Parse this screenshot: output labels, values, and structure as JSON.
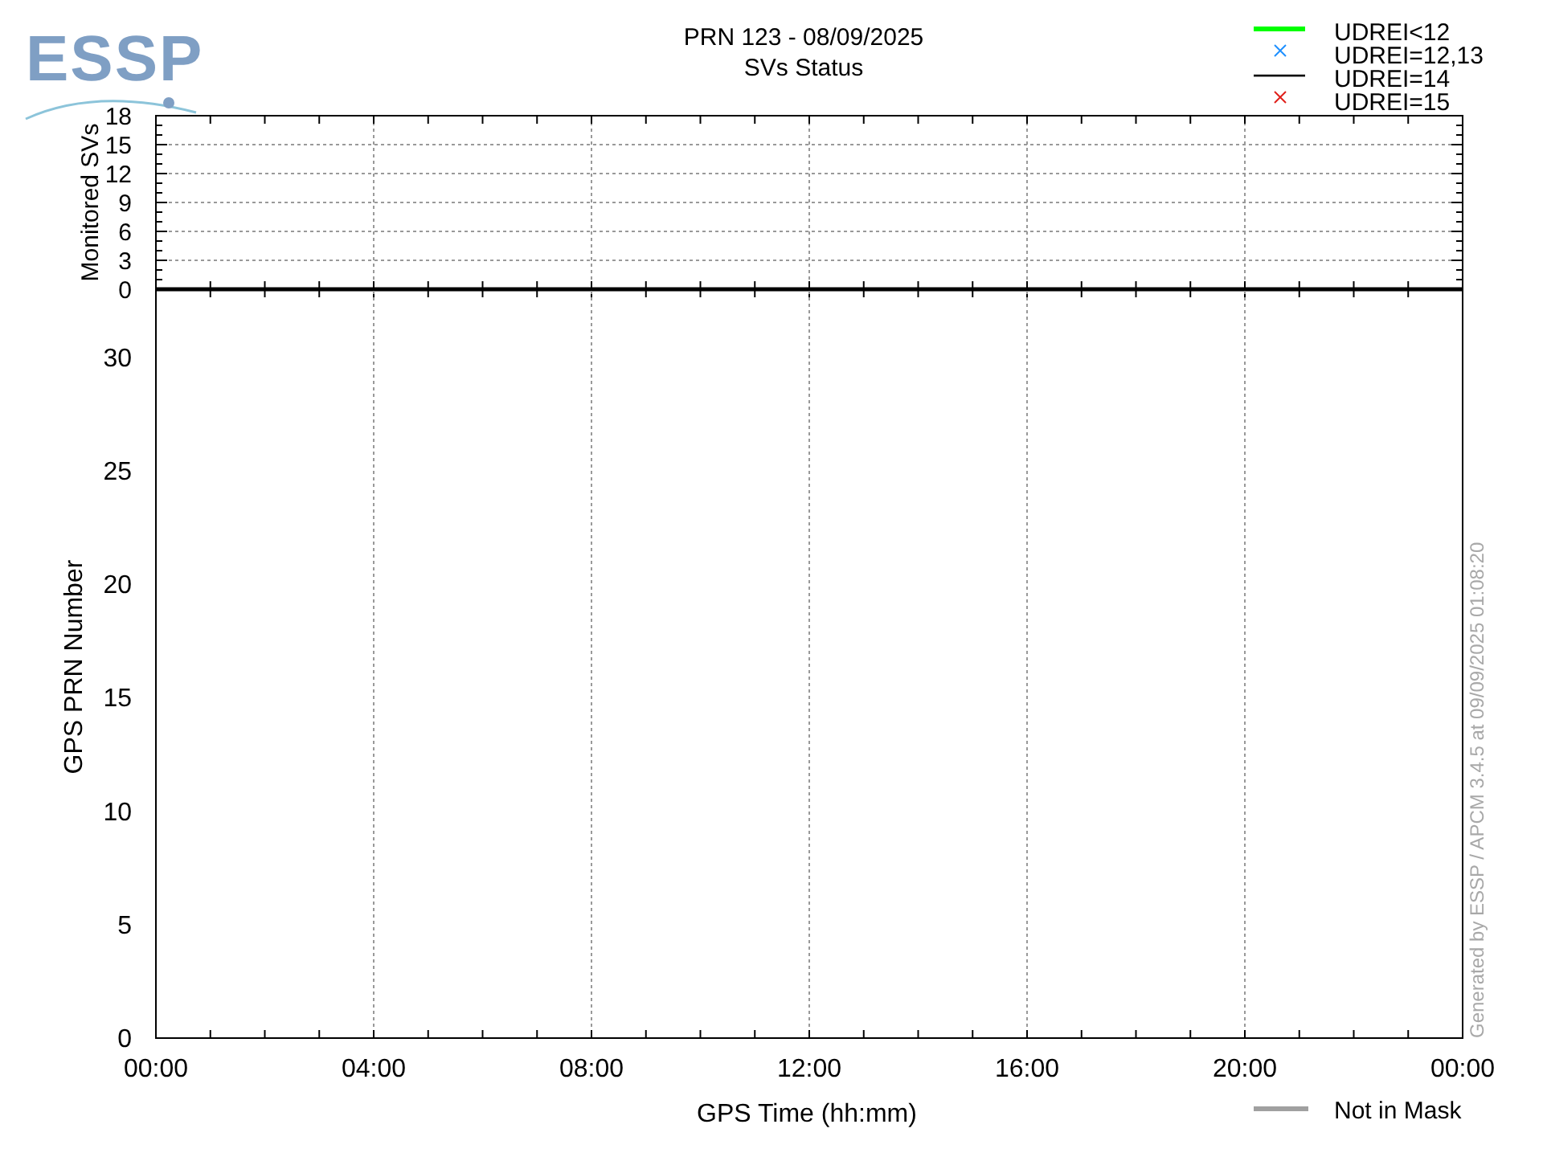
{
  "logo": {
    "text": "ESSP"
  },
  "title": {
    "lines": [
      "PRN 123 - 08/09/2025",
      "SVs Status"
    ]
  },
  "legend": [
    {
      "label": "UDREI<12",
      "kind": "line",
      "color": "#00ff00"
    },
    {
      "label": "UDREI=12,13",
      "kind": "cross",
      "color": "#1e90ff"
    },
    {
      "label": "UDREI=14",
      "kind": "line",
      "color": "#000000"
    },
    {
      "label": "UDREI=15",
      "kind": "cross",
      "color": "#e0201b"
    }
  ],
  "top_chart": {
    "chart_data": {
      "type": "line",
      "grid": true,
      "ylabel": "Monitored SVs",
      "xlim": [
        0,
        24
      ],
      "ylim": [
        0,
        18
      ],
      "yticks": [
        0,
        3,
        6,
        9,
        12,
        15,
        18
      ]
    }
  },
  "bottom_chart": {
    "chart_data": {
      "type": "line",
      "grid": true,
      "xlabel": "GPS Time (hh:mm)",
      "ylabel": "GPS PRN Number",
      "xlim": [
        0,
        24
      ],
      "ylim": [
        0,
        33
      ],
      "yticks": [
        0,
        5,
        10,
        15,
        20,
        25,
        30
      ],
      "xticks": [
        {
          "value": 0,
          "label": "00:00"
        },
        {
          "value": 4,
          "label": "04:00"
        },
        {
          "value": 8,
          "label": "08:00"
        },
        {
          "value": 12,
          "label": "12:00"
        },
        {
          "value": 16,
          "label": "16:00"
        },
        {
          "value": 20,
          "label": "20:00"
        },
        {
          "value": 24,
          "label": "00:00"
        }
      ]
    }
  },
  "bottom_legend": [
    {
      "label": "Not in Mask",
      "kind": "line",
      "color": "#a0a0a0"
    }
  ],
  "footer": {
    "generated": "Generated by ESSP / APCM 3.4.5 at 09/09/2025 01:08:20"
  }
}
